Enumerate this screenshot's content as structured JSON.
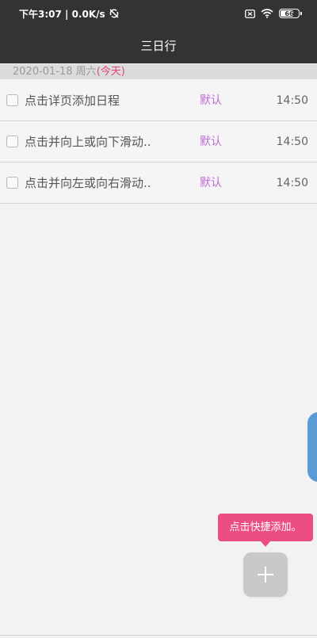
{
  "status_bar": {
    "time_speed": "下午3:07 | 0.0K/s",
    "battery_level": "66",
    "icons": [
      "sync-off-icon",
      "sim-icon",
      "wifi-icon",
      "battery-icon"
    ]
  },
  "app": {
    "title": "三日行"
  },
  "date_header": {
    "date": "2020-01-18 周六",
    "today_label": "(今天)"
  },
  "tasks": [
    {
      "title": "点击详页添加日程",
      "category": "默认",
      "time": "14:50",
      "checked": false
    },
    {
      "title": "点击并向上或向下滑动..",
      "category": "默认",
      "time": "14:50",
      "checked": false
    },
    {
      "title": "点击并向左或向右滑动..",
      "category": "默认",
      "time": "14:50",
      "checked": false
    }
  ],
  "tooltip": {
    "text": "点击快捷添加。"
  },
  "fab": {
    "icon": "plus-icon"
  },
  "colors": {
    "header_bg": "#333336",
    "category": "#c06ad8",
    "today": "#e0457b",
    "tooltip_bg": "#ec4d82",
    "fab_bg": "#c9c9c9",
    "edge_handle": "#5a9bd5"
  }
}
